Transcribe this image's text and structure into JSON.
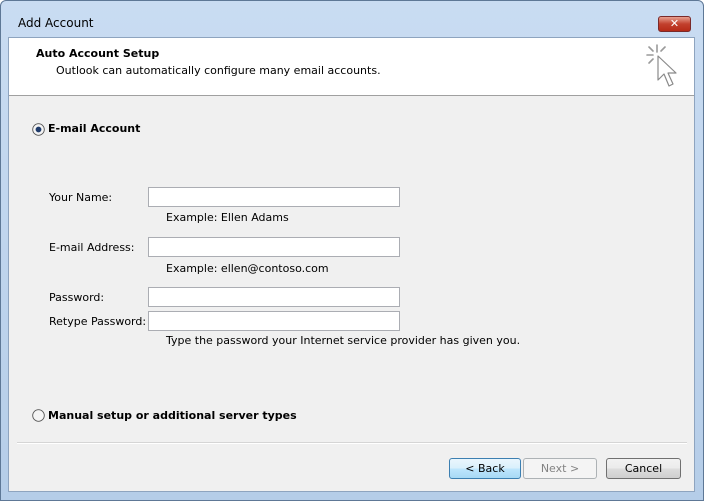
{
  "window": {
    "title": "Add Account",
    "close_glyph": "✕"
  },
  "header": {
    "title": "Auto Account Setup",
    "subtitle": "Outlook can automatically configure many email accounts.",
    "icon": "magic-wand-cursor-icon"
  },
  "options": {
    "email_account": {
      "label": "E-mail Account",
      "selected": true
    },
    "manual_setup": {
      "label": "Manual setup or additional server types",
      "selected": false
    }
  },
  "form": {
    "your_name": {
      "label": "Your Name:",
      "value": "",
      "hint": "Example: Ellen Adams"
    },
    "email_address": {
      "label": "E-mail Address:",
      "value": "",
      "hint": "Example: ellen@contoso.com"
    },
    "password": {
      "label": "Password:",
      "value": ""
    },
    "retype_password": {
      "label": "Retype Password:",
      "value": "",
      "hint": "Type the password your Internet service provider has given you."
    }
  },
  "buttons": {
    "back": "< Back",
    "next": "Next >",
    "cancel": "Cancel"
  }
}
